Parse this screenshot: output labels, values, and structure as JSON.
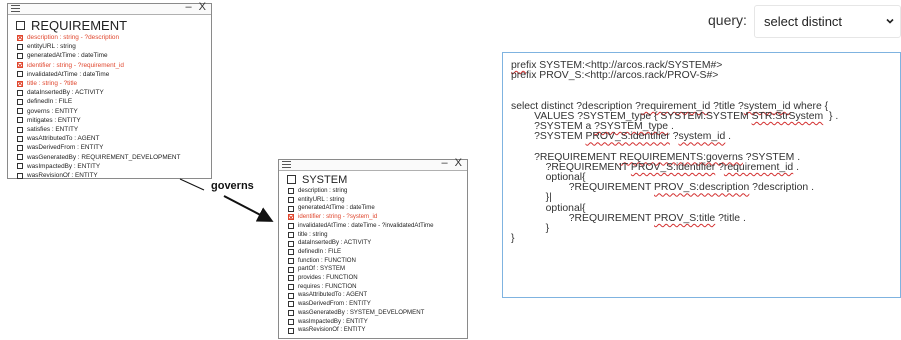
{
  "requirement_class": {
    "title": "REQUIREMENT",
    "window_controls": "– X",
    "properties": [
      {
        "text": "description : string - ?description",
        "highlighted": true
      },
      {
        "text": "entityURL : string",
        "highlighted": false
      },
      {
        "text": "generatedAtTime : dateTime",
        "highlighted": false
      },
      {
        "text": "identifier : string - ?requirement_id",
        "highlighted": true
      },
      {
        "text": "invalidatedAtTime : dateTime",
        "highlighted": false
      },
      {
        "text": "title : string - ?title",
        "highlighted": true
      },
      {
        "text": "dataInsertedBy : ACTIVITY",
        "highlighted": false
      },
      {
        "text": "definedIn : FILE",
        "highlighted": false
      },
      {
        "text": "governs : ENTITY",
        "highlighted": false
      },
      {
        "text": "mitigates : ENTITY",
        "highlighted": false
      },
      {
        "text": "satisfies : ENTITY",
        "highlighted": false
      },
      {
        "text": "wasAttributedTo : AGENT",
        "highlighted": false
      },
      {
        "text": "wasDerivedFrom : ENTITY",
        "highlighted": false
      },
      {
        "text": "wasGeneratedBy : REQUIREMENT_DEVELOPMENT",
        "highlighted": false
      },
      {
        "text": "wasImpactedBy : ENTITY",
        "highlighted": false
      },
      {
        "text": "wasRevisionOf : ENTITY",
        "highlighted": false
      }
    ]
  },
  "system_class": {
    "title": "SYSTEM",
    "window_controls": "– X",
    "properties": [
      {
        "text": "description : string",
        "highlighted": false
      },
      {
        "text": "entityURL : string",
        "highlighted": false
      },
      {
        "text": "generatedAtTime : dateTime",
        "highlighted": false
      },
      {
        "text": "identifier : string - ?system_id",
        "highlighted": true
      },
      {
        "text": "invalidatedAtTime : dateTime - ?invalidatedAtTime",
        "highlighted": false
      },
      {
        "text": "title : string",
        "highlighted": false
      },
      {
        "text": "dataInsertedBy : ACTIVITY",
        "highlighted": false
      },
      {
        "text": "definedIn : FILE",
        "highlighted": false
      },
      {
        "text": "function : FUNCTION",
        "highlighted": false
      },
      {
        "text": "partOf : SYSTEM",
        "highlighted": false
      },
      {
        "text": "provides : FUNCTION",
        "highlighted": false
      },
      {
        "text": "requires : FUNCTION",
        "highlighted": false
      },
      {
        "text": "wasAttributedTo : AGENT",
        "highlighted": false
      },
      {
        "text": "wasDerivedFrom : ENTITY",
        "highlighted": false
      },
      {
        "text": "wasGeneratedBy : SYSTEM_DEVELOPMENT",
        "highlighted": false
      },
      {
        "text": "wasImpactedBy : ENTITY",
        "highlighted": false
      },
      {
        "text": "wasRevisionOf : ENTITY",
        "highlighted": false
      }
    ]
  },
  "connection": {
    "label": "governs"
  },
  "query": {
    "label": "query:",
    "selected": "select distinct"
  },
  "editor": {
    "lines": [
      "prefix SYSTEM:<http://arcos.rack/SYSTEM#>",
      "prefix PROV_S:<http://arcos.rack/PROV-S#>",
      "",
      "",
      "select distinct ?description ?requirement_id ?title ?system_id where {",
      "        VALUES ?SYSTEM_type { SYSTEM:SYSTEM STR:StrSystem  } .",
      "        ?SYSTEM a ?SYSTEM_type .",
      "        ?SYSTEM PROV_S:identifier ?system_id .",
      "",
      "        ?REQUIREMENT REQUIREMENTS:governs ?SYSTEM .",
      "            ?REQUIREMENT PROV_S:identifier ?requirement_id .",
      "            optional{",
      "                    ?REQUIREMENT PROV_S:description ?description .",
      "            }|",
      "            optional{",
      "                    ?REQUIREMENT PROV_S:title ?title .",
      "            }",
      "}"
    ]
  },
  "colors": {
    "highlight": "#e0462d",
    "editor_border": "#7fb3e0",
    "squiggle": "#d32f2f"
  }
}
